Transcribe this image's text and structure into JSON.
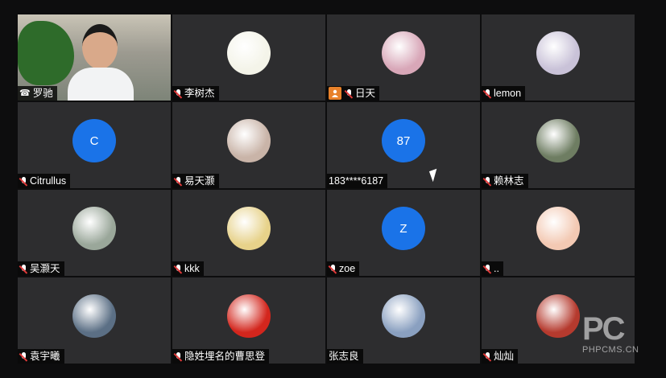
{
  "participants": [
    {
      "name": "罗驰",
      "avatar": "video",
      "status": "phone",
      "active": true
    },
    {
      "name": "李树杰",
      "avatar": "pic",
      "status": "muted",
      "pic_color": "#f4f4e9"
    },
    {
      "name": "日天",
      "avatar": "pic",
      "status": "muted",
      "host": true,
      "pic_color": "#d8a7b8"
    },
    {
      "name": "lemon",
      "avatar": "pic",
      "status": "muted",
      "pic_color": "#c9c2d8"
    },
    {
      "name": "Citrullus",
      "avatar": "letter",
      "letter": "C",
      "status": "muted"
    },
    {
      "name": "易天灏",
      "avatar": "pic",
      "status": "muted",
      "pic_color": "#c9b4a8"
    },
    {
      "name": "183****6187",
      "avatar": "letter",
      "letter": "87",
      "status": "none"
    },
    {
      "name": "赖林志",
      "avatar": "pic",
      "status": "muted",
      "pic_color": "#6e7d62"
    },
    {
      "name": "吴灏天",
      "avatar": "pic",
      "status": "muted",
      "pic_color": "#9aa79a"
    },
    {
      "name": "kkk",
      "avatar": "pic",
      "status": "muted",
      "pic_color": "#e7d28a"
    },
    {
      "name": "zoe",
      "avatar": "letter",
      "letter": "Z",
      "status": "muted"
    },
    {
      "name": "..",
      "avatar": "pic",
      "status": "muted",
      "pic_color": "#f3c9b3"
    },
    {
      "name": "袁宇曦",
      "avatar": "pic",
      "status": "muted",
      "pic_color": "#5b6f85"
    },
    {
      "name": "隐姓埋名的曹思登",
      "avatar": "pic",
      "status": "muted",
      "pic_color": "#d3261d"
    },
    {
      "name": "张志良",
      "avatar": "pic",
      "status": "none",
      "pic_color": "#8aa0c0"
    },
    {
      "name": "灿灿",
      "avatar": "pic",
      "status": "muted",
      "pic_color": "#b53a2e"
    }
  ],
  "watermark": {
    "logo": "PC",
    "site": "PHPCMS.CN"
  },
  "colors": {
    "accent_blue": "#1a73e8",
    "active_border": "#3ec35a",
    "host_badge": "#e8812a"
  }
}
